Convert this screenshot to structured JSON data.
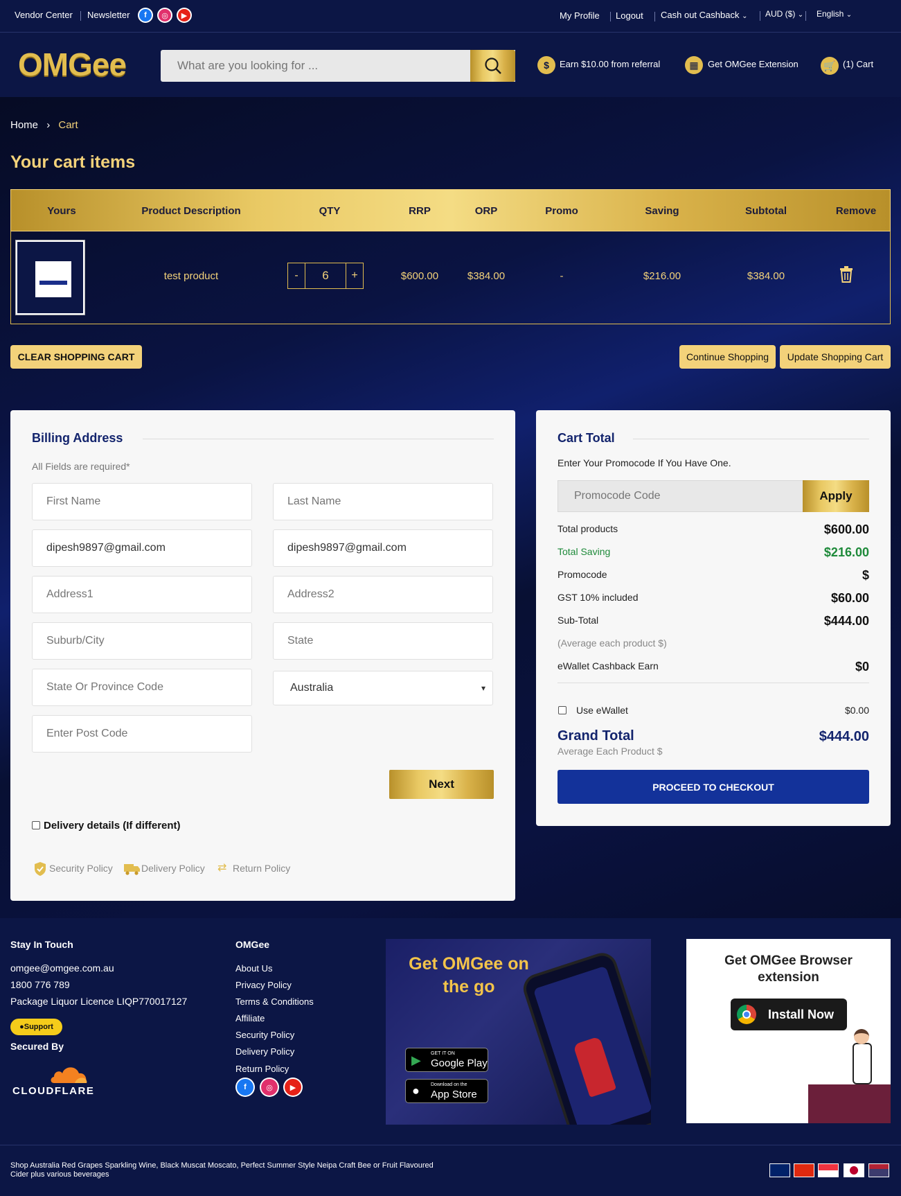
{
  "topbar": {
    "vendor_center": "Vendor Center",
    "newsletter": "Newsletter",
    "my_profile": "My Profile",
    "logout": "Logout",
    "cashout": "Cash out Cashback",
    "currency": "AUD ($)",
    "language": "English"
  },
  "header": {
    "logo": "OMGee",
    "search_placeholder": "What are you looking for ...",
    "referral": "Earn $10.00 from referral",
    "extension": "Get OMGee Extension",
    "cart": "(1) Cart"
  },
  "breadcrumb": {
    "home": "Home",
    "current": "Cart"
  },
  "cart": {
    "title": "Your cart items",
    "columns": [
      "Yours",
      "Product Description",
      "QTY",
      "RRP",
      "ORP",
      "Promo",
      "Saving",
      "Subtotal",
      "Remove"
    ],
    "items": [
      {
        "name": "test product",
        "qty": "6",
        "rrp": "$600.00",
        "orp": "$384.00",
        "promo": "-",
        "saving": "$216.00",
        "subtotal": "$384.00"
      }
    ],
    "clear_label": "CLEAR SHOPPING CART",
    "continue_label": "Continue Shopping",
    "update_label": "Update Shopping Cart"
  },
  "billing": {
    "title": "Billing Address",
    "required_note": "All Fields are required*",
    "first_name_ph": "First Name",
    "last_name_ph": "Last Name",
    "email1": "dipesh9897@gmail.com",
    "email2": "dipesh9897@gmail.com",
    "address1_ph": "Address1",
    "address2_ph": "Address2",
    "city_ph": "Suburb/City",
    "state_ph": "State",
    "province_ph": "State Or Province Code",
    "country": "Australia",
    "postcode_ph": "Enter Post Code",
    "next_label": "Next",
    "delivery_label": "Delivery details (If different)",
    "policies": [
      "Security Policy",
      "Delivery Policy",
      "Return Policy"
    ]
  },
  "totals": {
    "title": "Cart Total",
    "promo_prompt": "Enter Your Promocode If You Have One.",
    "promo_ph": "Promocode Code",
    "apply_label": "Apply",
    "total_products_label": "Total products",
    "total_products": "$600.00",
    "total_saving_label": "Total Saving",
    "total_saving": "$216.00",
    "promocode_label": "Promocode",
    "promocode": "$",
    "gst_label": "GST 10% included",
    "gst": "$60.00",
    "subtotal_label": "Sub-Total",
    "subtotal": "$444.00",
    "avg_label": "(Average each product $)",
    "ewallet_earn_label": "eWallet Cashback Earn",
    "ewallet_earn": "$0",
    "use_ewallet_label": "Use eWallet",
    "use_ewallet": "$0.00",
    "grand_total_label": "Grand Total",
    "grand_total_sub": "Average Each Product $",
    "grand_total": "$444.00",
    "checkout_label": "PROCEED TO CHECKOUT",
    "colors": {
      "saving": "#1e8a3a",
      "accent": "#13246d",
      "gold": "#e2bd4f"
    }
  },
  "footer": {
    "stay_title": "Stay In Touch",
    "email": "omgee@omgee.com.au",
    "phone": "1800 776 789",
    "licence": "Package Liquor Licence LIQP770017127",
    "support": "Support",
    "secured_by": "Secured By",
    "cloudflare": "CLOUDFLARE",
    "omgee_title": "OMGee",
    "links": [
      "About Us",
      "Privacy Policy",
      "Terms & Conditions",
      "Affiliate",
      "Security Policy",
      "Delivery Policy",
      "Return Policy"
    ],
    "app_promo": "Get OMGee on the go",
    "google_play_small": "GET IT ON",
    "google_play": "Google Play",
    "app_store_small": "Download on the",
    "app_store": "App Store",
    "browser_ext": "Get OMGee Browser extension",
    "install_now": "Install Now",
    "bottom_text": "Shop Australia Red Grapes Sparkling Wine, Black Muscat Moscato, Perfect Summer Style Neipa Craft Bee or Fruit Flavoured Cider plus various beverages"
  }
}
